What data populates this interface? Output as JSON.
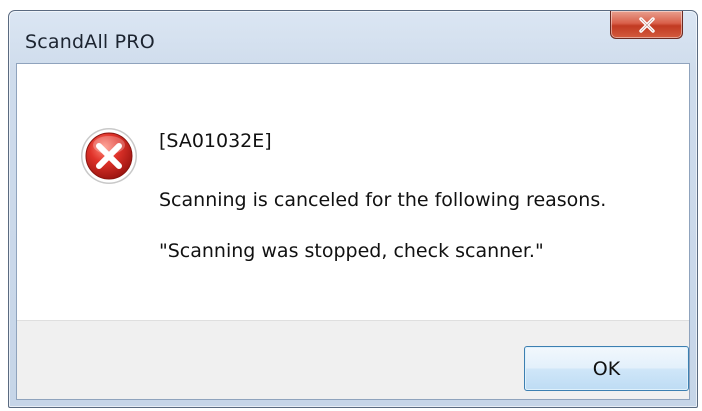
{
  "window": {
    "title": "ScandAll PRO"
  },
  "message": {
    "code": "[SA01032E]",
    "reason": "Scanning is canceled for the following reasons.",
    "detail": "\"Scanning was stopped, check scanner.\""
  },
  "buttons": {
    "ok_label": "OK"
  },
  "icons": {
    "close": "close-icon",
    "error": "error-icon"
  },
  "colors": {
    "close_button": "#c9432b",
    "error_icon": "#d0251f",
    "ok_border": "#3c7fb1"
  }
}
